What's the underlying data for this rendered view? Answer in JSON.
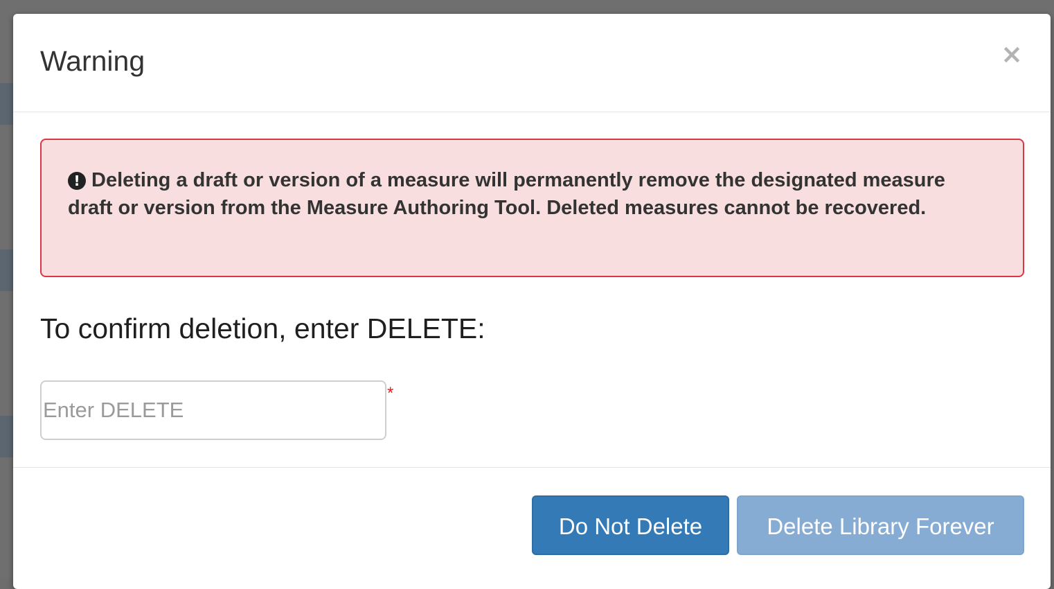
{
  "modal": {
    "title": "Warning",
    "close_symbol": "×",
    "close_icon": "close-icon"
  },
  "alert": {
    "icon": "exclamation-circle-icon",
    "icon_glyph": "!",
    "message": "Deleting a draft or version of a measure will permanently remove the designated measure draft or version from the Measure Authoring Tool. Deleted measures cannot be recovered.",
    "background_color": "#f8dede",
    "border_color": "#dc3545"
  },
  "confirm": {
    "label": "To confirm deletion, enter DELETE:",
    "input_value": "",
    "input_placeholder": "Enter DELETE",
    "required_marker": "*"
  },
  "footer": {
    "keep_label": "Do Not Delete",
    "delete_label": "Delete Library Forever",
    "keep_color": "#337ab7",
    "delete_color": "#86acd3",
    "delete_disabled": true
  }
}
